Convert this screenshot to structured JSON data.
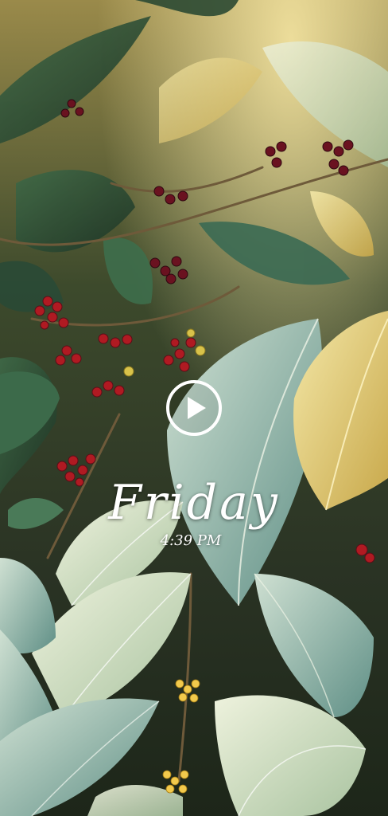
{
  "story": {
    "day_label": "Friday",
    "time_label": "4:39 PM"
  },
  "controls": {
    "play_icon": "play-circle-icon",
    "play_color": "#ffffff"
  },
  "colors": {
    "leaf_light": "#dfe8cf",
    "leaf_green": "#4f7a50",
    "leaf_dark": "#24402a",
    "leaf_teal": "#6f9a8f",
    "leaf_gold": "#e2c878",
    "cherry_red": "#b01a22",
    "cherry_dark": "#5a0e18",
    "flower_yellow": "#f2c94c"
  }
}
